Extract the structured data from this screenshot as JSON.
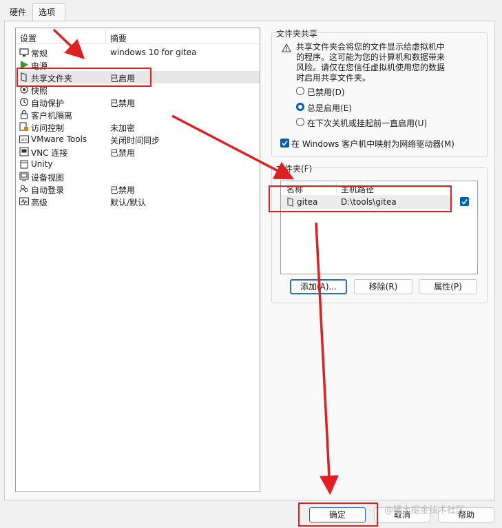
{
  "tabs": [
    {
      "label": "硬件",
      "active": false
    },
    {
      "label": "选项",
      "active": true
    }
  ],
  "settings": {
    "col_setting": "设置",
    "col_summary": "摘要",
    "rows": [
      {
        "name": "常规",
        "summary": "windows 10 for gitea",
        "icon": "monitor-icon"
      },
      {
        "name": "电源",
        "summary": "",
        "icon": "play-icon"
      },
      {
        "name": "共享文件夹",
        "summary": "已启用",
        "icon": "shared-folder-icon",
        "selected": true
      },
      {
        "name": "快照",
        "summary": "",
        "icon": "snapshot-icon"
      },
      {
        "name": "自动保护",
        "summary": "已禁用",
        "icon": "clock-icon"
      },
      {
        "name": "客户机隔离",
        "summary": "",
        "icon": "lock-icon"
      },
      {
        "name": "访问控制",
        "summary": "未加密",
        "icon": "access-control-icon"
      },
      {
        "name": "VMware Tools",
        "summary": "关闭时间同步",
        "icon": "vmware-tools-icon"
      },
      {
        "name": "VNC 连接",
        "summary": "已禁用",
        "icon": "vnc-icon"
      },
      {
        "name": "Unity",
        "summary": "",
        "icon": "unity-icon"
      },
      {
        "name": "设备视图",
        "summary": "",
        "icon": "device-view-icon"
      },
      {
        "name": "自动登录",
        "summary": "已禁用",
        "icon": "users-icon"
      },
      {
        "name": "高级",
        "summary": "默认/默认",
        "icon": "advanced-icon"
      }
    ]
  },
  "sharing": {
    "title": "文件夹共享",
    "warning_lines": [
      "共享文件夹会将您的文件显示给虚拟机中",
      "的程序。这可能为您的计算机和数据带来",
      "风险。请仅在您信任虚拟机使用您的数据",
      "时启用共享文件夹。"
    ],
    "options": [
      {
        "label": "已禁用(D)",
        "checked": false
      },
      {
        "label": "总是启用(E)",
        "checked": true
      },
      {
        "label": "在下次关机或挂起前一直启用(U)",
        "checked": false
      }
    ],
    "map_drive_label": "在 Windows 客户机中映射为网络驱动器(M)",
    "map_drive_checked": true
  },
  "folders": {
    "title": "文件夹(F)",
    "col_name": "名称",
    "col_path": "主机路径",
    "rows": [
      {
        "name": "gitea",
        "path": "D:\\tools\\gitea",
        "enabled": true
      }
    ],
    "add_label": "添加(A)...",
    "remove_label": "移除(R)",
    "properties_label": "属性(P)"
  },
  "footer": {
    "ok_label": "确定",
    "cancel_label": "取消",
    "help_label": "帮助"
  },
  "watermark": "@稀土掘金技术社区",
  "colors": {
    "accent": "#005fb8",
    "annotation": "#e02020"
  }
}
